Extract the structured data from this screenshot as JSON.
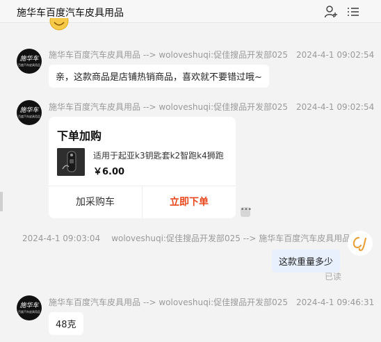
{
  "header": {
    "title": "施华车百度汽车皮具用品",
    "icons": [
      "add-user-icon",
      "more-icon"
    ]
  },
  "messages": [
    {
      "sender": "施华车百度汽车皮具用品 --> woloveshuqi:促佳搜品开发部025",
      "time": "2024-4-1 09:02:54",
      "text": "亲，这款商品是店铺热销商品，喜欢就不要错过哦~"
    },
    {
      "sender": "施华车百度汽车皮具用品 --> woloveshuqi:促佳搜品开发部025",
      "time": "2024-4-1 09:02:54",
      "card": {
        "title": "下单加购",
        "product_name": "适用于起亚k3钥匙套k2智跑k4狮跑",
        "price": "￥6.00",
        "cart_label": "加采购车",
        "buy_label": "立即下单"
      }
    },
    {
      "sender": "woloveshuqi:促佳搜品开发部025 --> 施华车百度汽车皮具用品",
      "time": "2024-4-1 09:03:04",
      "text": "这款重量多少",
      "status": "已读"
    },
    {
      "sender": "施华车百度汽车皮具用品 --> woloveshuqi:促佳搜品开发部025",
      "time": "2024-4-1 09:46:31",
      "text": "48克"
    }
  ],
  "avatar_logo": "施华车",
  "avatar_sub": "百度汽车皮具用品",
  "colors": {
    "accent": "#e8471c",
    "self_bubble": "#e8f0fe",
    "background": "#f3f3f3"
  }
}
